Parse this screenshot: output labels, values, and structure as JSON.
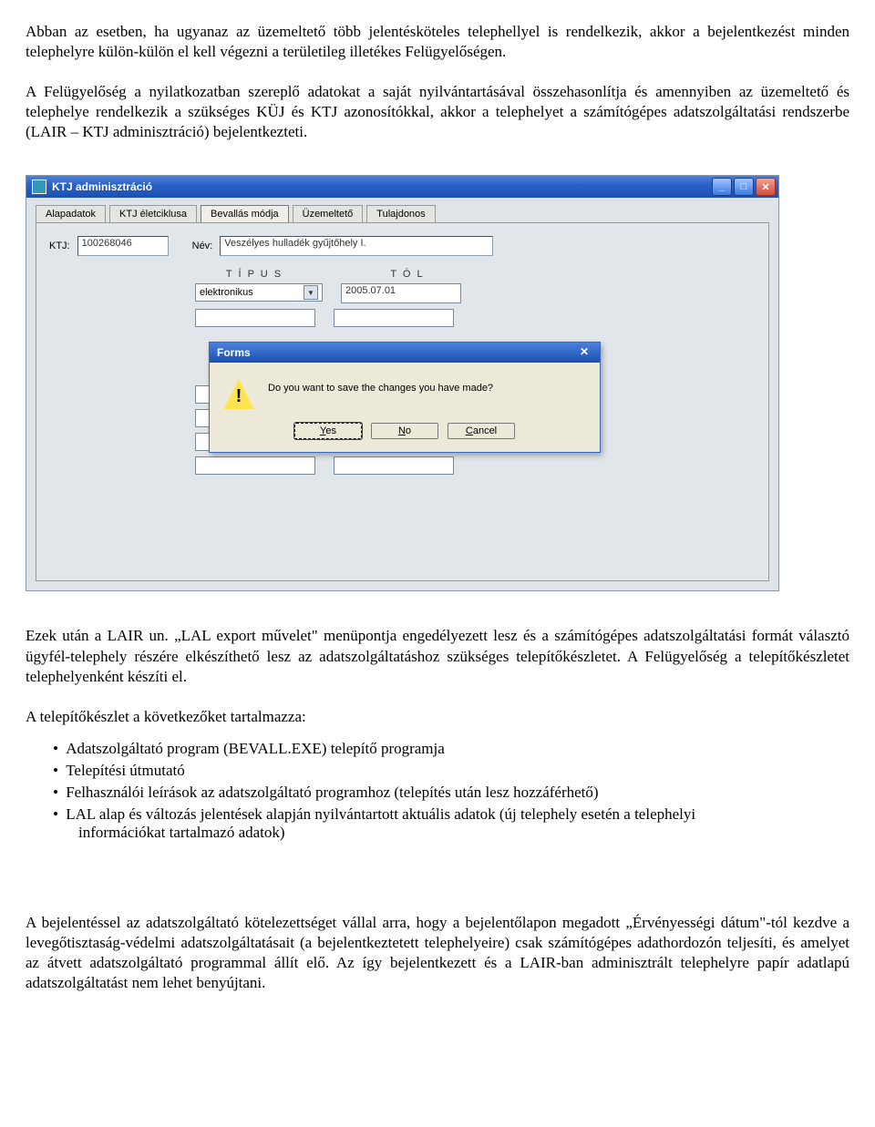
{
  "para1": "Abban az esetben, ha ugyanaz az üzemeltető több jelentésköteles telephellyel is rendelkezik, akkor a bejelentkezést minden telephelyre külön-külön el kell végezni a területileg illetékes Felügyelőségen.",
  "para2": "A Felügyelőség a nyilatkozatban szereplő adatokat a saját nyilvántartásával összehasonlítja és amennyiben az üzemeltető és telephelye rendelkezik a szükséges KÜJ és KTJ azonosítókkal, akkor a telephelyet a számítógépes adatszolgáltatási rendszerbe (LAIR – KTJ adminisztráció) bejelentkezteti.",
  "app": {
    "title": "KTJ adminisztráció",
    "tabs": [
      "Alapadatok",
      "KTJ életciklusa",
      "Bevallás módja",
      "Üzemeltető",
      "Tulajdonos"
    ],
    "activeTab": 2,
    "ktj_label": "KTJ:",
    "ktj_value": "100268046",
    "nev_label": "Név:",
    "nev_value": "Veszélyes hulladék gyűjtőhely I.",
    "col_tipus": "T Í P U S",
    "col_tol": "T Ó L",
    "select_value": "elektronikus",
    "date_value": "2005.07.01"
  },
  "dialog": {
    "title": "Forms",
    "message": "Do you want to save the changes you have made?",
    "yes": "Yes",
    "no": "No",
    "cancel": "Cancel"
  },
  "para3": "Ezek után a LAIR un. „LAL export művelet\" menüpontja engedélyezett lesz és a számítógépes adatszolgáltatási formát választó ügyfél-telephely részére elkészíthető lesz az adatszolgáltatáshoz szükséges telepítőkészletet. A Felügyelőség a telepítőkészletet telephelyenként készíti el.",
  "para4": "A telepítőkészlet a következőket tartalmazza:",
  "bullets": {
    "b1": "Adatszolgáltató program (BEVALL.EXE) telepítő programja",
    "b2": "Telepítési útmutató",
    "b3": "Felhasználói leírások az adatszolgáltató programhoz (telepítés után lesz hozzáférhető)",
    "b4a": "LAL alap és változás jelentések alapján nyilvántartott aktuális adatok (új telephely esetén a telephelyi",
    "b4b": "információkat tartalmazó adatok)"
  },
  "para5": "A bejelentéssel az adatszolgáltató kötelezettséget vállal arra, hogy a bejelentőlapon megadott „Érvényességi dátum\"-tól kezdve a levegőtisztaság-védelmi adatszolgáltatásait (a bejelentkeztetett telephelyeire) csak számítógépes adathordozón teljesíti, és amelyet az átvett adatszolgáltató programmal állít elő. Az így bejelentkezett és a LAIR-ban adminisztrált telephelyre papír adatlapú adatszolgáltatást nem lehet benyújtani."
}
